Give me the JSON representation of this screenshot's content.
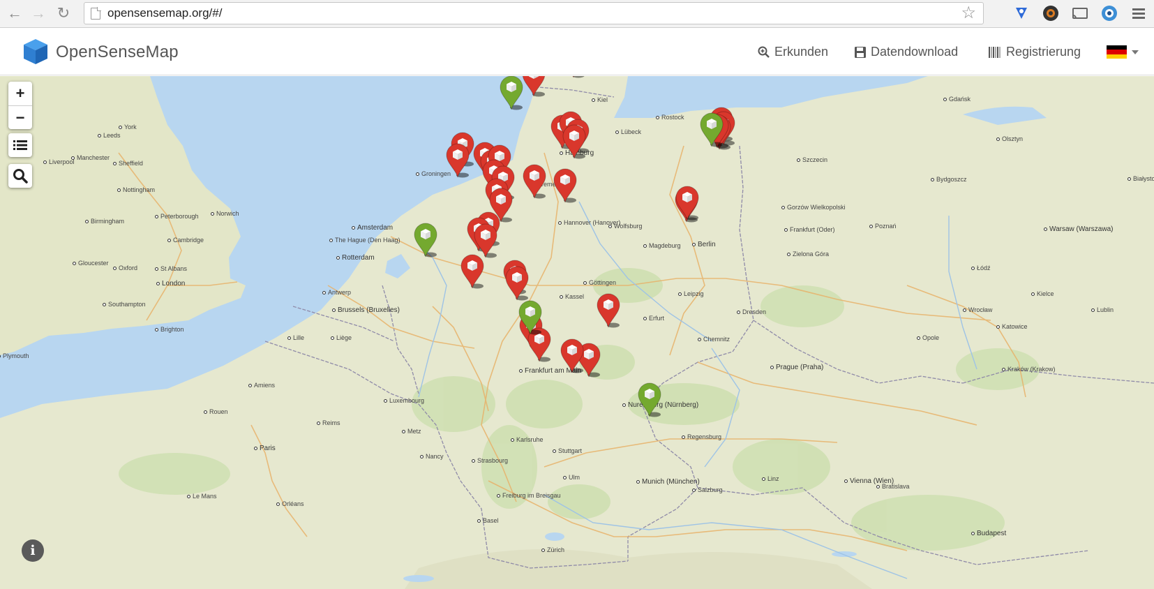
{
  "browser": {
    "url": "opensensemap.org/#/"
  },
  "navbar": {
    "brand": "OpenSenseMap",
    "links": [
      {
        "label": "Erkunden",
        "icon": "search-plus-icon"
      },
      {
        "label": "Datendownload",
        "icon": "floppy-icon"
      },
      {
        "label": "Registrierung",
        "icon": "barcode-icon"
      }
    ],
    "language_flag": "de-flag-icon"
  },
  "map": {
    "controls": {
      "zoom_in": "+",
      "zoom_out": "−"
    },
    "colors": {
      "station_active": "#d9372c",
      "station_highlight": "#74a92f",
      "water": "#b8d6f0",
      "land": "#e6e8cf"
    },
    "cities": [
      "Leeds",
      "York",
      "Manchester",
      "Sheffield",
      "Liverpool",
      "Nottingham",
      "Birmingham",
      "Peterborough",
      "Norwich",
      "Cambridge",
      "Gloucester",
      "Oxford",
      "London",
      "St Albans",
      "Southampton",
      "Brighton",
      "Plymouth",
      "Amsterdam",
      "The Hague (Den Haag)",
      "Rotterdam",
      "Antwerp",
      "Brussels (Bruxelles)",
      "Liège",
      "Lille",
      "Paris",
      "Amiens",
      "Rouen",
      "Reims",
      "Le Mans",
      "Orléans",
      "Luxembourg",
      "Metz",
      "Nancy",
      "Strasbourg",
      "Groningen",
      "Bremen",
      "Hamburg",
      "Rostock",
      "Lübeck",
      "Kiel",
      "Hannover (Hanover)",
      "Wolfsburg",
      "Magdeburg",
      "Berlin",
      "Leipzig",
      "Dresden",
      "Chemnitz",
      "Erfurt",
      "Kassel",
      "Göttingen",
      "Frankfurt am Main",
      "Karlsruhe",
      "Stuttgart",
      "Nuremberg (Nürnberg)",
      "Regensburg",
      "Ulm",
      "Munich (München)",
      "Freiburg im Breisgau",
      "Basel",
      "Zürich",
      "Salzburg",
      "Linz",
      "Vienna (Wien)",
      "Bratislava",
      "Prague (Praha)",
      "Wrocław",
      "Poznań",
      "Szczecin",
      "Łódź",
      "Warsaw (Warszawa)",
      "Kraków (Krakow)",
      "Katowice",
      "Budapest",
      "Gdańsk",
      "Bydgoszcz",
      "Olsztyn",
      "Białystok",
      "Lublin",
      "Kielce",
      "Opole",
      "Gorzów Wielkopolski",
      "Zielona Góra",
      "Frankfurt (Oder)"
    ],
    "stations": [
      {
        "status": "active"
      },
      {
        "status": "active"
      },
      {
        "status": "active"
      },
      {
        "status": "active"
      },
      {
        "status": "active"
      },
      {
        "status": "active"
      },
      {
        "status": "active"
      },
      {
        "status": "active"
      },
      {
        "status": "active"
      },
      {
        "status": "active"
      },
      {
        "status": "active"
      },
      {
        "status": "active"
      },
      {
        "status": "active"
      },
      {
        "status": "active"
      },
      {
        "status": "active"
      },
      {
        "status": "active"
      },
      {
        "status": "active"
      },
      {
        "status": "active"
      },
      {
        "status": "active"
      },
      {
        "status": "active"
      },
      {
        "status": "active"
      },
      {
        "status": "active"
      },
      {
        "status": "active"
      },
      {
        "status": "active"
      },
      {
        "status": "active"
      },
      {
        "status": "active"
      },
      {
        "status": "active"
      },
      {
        "status": "active"
      },
      {
        "status": "active"
      },
      {
        "status": "active"
      },
      {
        "status": "active"
      },
      {
        "status": "active"
      },
      {
        "status": "active"
      },
      {
        "status": "active"
      },
      {
        "status": "active"
      },
      {
        "status": "active"
      },
      {
        "status": "highlight"
      },
      {
        "status": "highlight"
      },
      {
        "status": "highlight"
      },
      {
        "status": "highlight"
      },
      {
        "status": "highlight"
      }
    ]
  }
}
